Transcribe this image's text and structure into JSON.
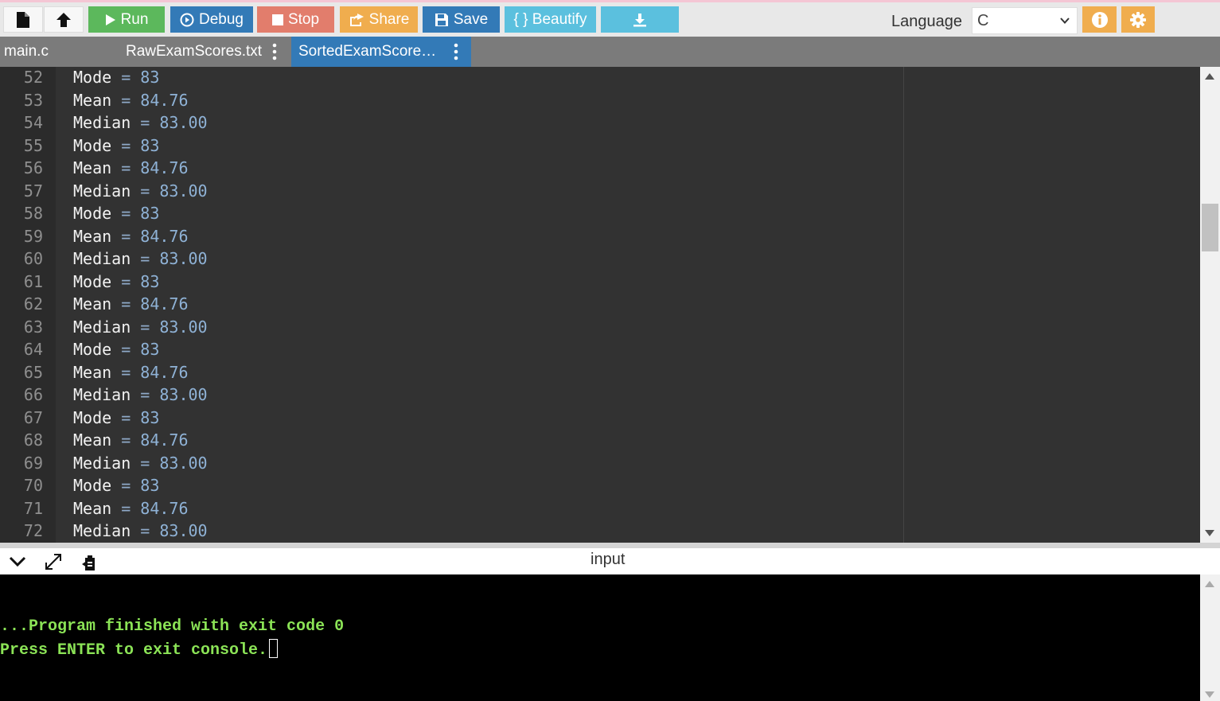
{
  "toolbar": {
    "run_label": "Run",
    "debug_label": "Debug",
    "stop_label": "Stop",
    "share_label": "Share",
    "save_label": "Save",
    "beautify_label": "{ } Beautify",
    "language_label": "Language",
    "language_value": "C"
  },
  "tabs": [
    {
      "label": "main.c"
    },
    {
      "label": "RawExamScores.txt"
    },
    {
      "label": "SortedExamScore…"
    }
  ],
  "editor": {
    "lines": [
      {
        "n": "52",
        "name": "Mode",
        "value": "83"
      },
      {
        "n": "53",
        "name": "Mean",
        "value": "84.76"
      },
      {
        "n": "54",
        "name": "Median",
        "value": "83.00"
      },
      {
        "n": "55",
        "name": "Mode",
        "value": "83"
      },
      {
        "n": "56",
        "name": "Mean",
        "value": "84.76"
      },
      {
        "n": "57",
        "name": "Median",
        "value": "83.00"
      },
      {
        "n": "58",
        "name": "Mode",
        "value": "83"
      },
      {
        "n": "59",
        "name": "Mean",
        "value": "84.76"
      },
      {
        "n": "60",
        "name": "Median",
        "value": "83.00"
      },
      {
        "n": "61",
        "name": "Mode",
        "value": "83"
      },
      {
        "n": "62",
        "name": "Mean",
        "value": "84.76"
      },
      {
        "n": "63",
        "name": "Median",
        "value": "83.00"
      },
      {
        "n": "64",
        "name": "Mode",
        "value": "83"
      },
      {
        "n": "65",
        "name": "Mean",
        "value": "84.76"
      },
      {
        "n": "66",
        "name": "Median",
        "value": "83.00"
      },
      {
        "n": "67",
        "name": "Mode",
        "value": "83"
      },
      {
        "n": "68",
        "name": "Mean",
        "value": "84.76"
      },
      {
        "n": "69",
        "name": "Median",
        "value": "83.00"
      },
      {
        "n": "70",
        "name": "Mode",
        "value": "83"
      },
      {
        "n": "71",
        "name": "Mean",
        "value": "84.76"
      },
      {
        "n": "72",
        "name": "Median",
        "value": "83.00"
      }
    ]
  },
  "console": {
    "input_label": "input",
    "finished_text": "...Program finished with exit code 0",
    "prompt_text": "Press ENTER to exit console."
  },
  "colors": {
    "run": "#5cb85c",
    "debug": "#337ab7",
    "stop": "#e27d6c",
    "share": "#f0ad4e",
    "save": "#337ab7",
    "beautify": "#5bc0de",
    "download": "#5bc0de",
    "console_text": "#8be356"
  },
  "icons": [
    "new-file-icon",
    "upload-icon",
    "play-icon",
    "debug-icon",
    "stop-icon",
    "share-icon",
    "save-icon",
    "download-icon",
    "info-icon",
    "gear-icon",
    "chevron-down-icon",
    "expand-icon",
    "clear-console-icon",
    "kebab-menu-icon"
  ]
}
